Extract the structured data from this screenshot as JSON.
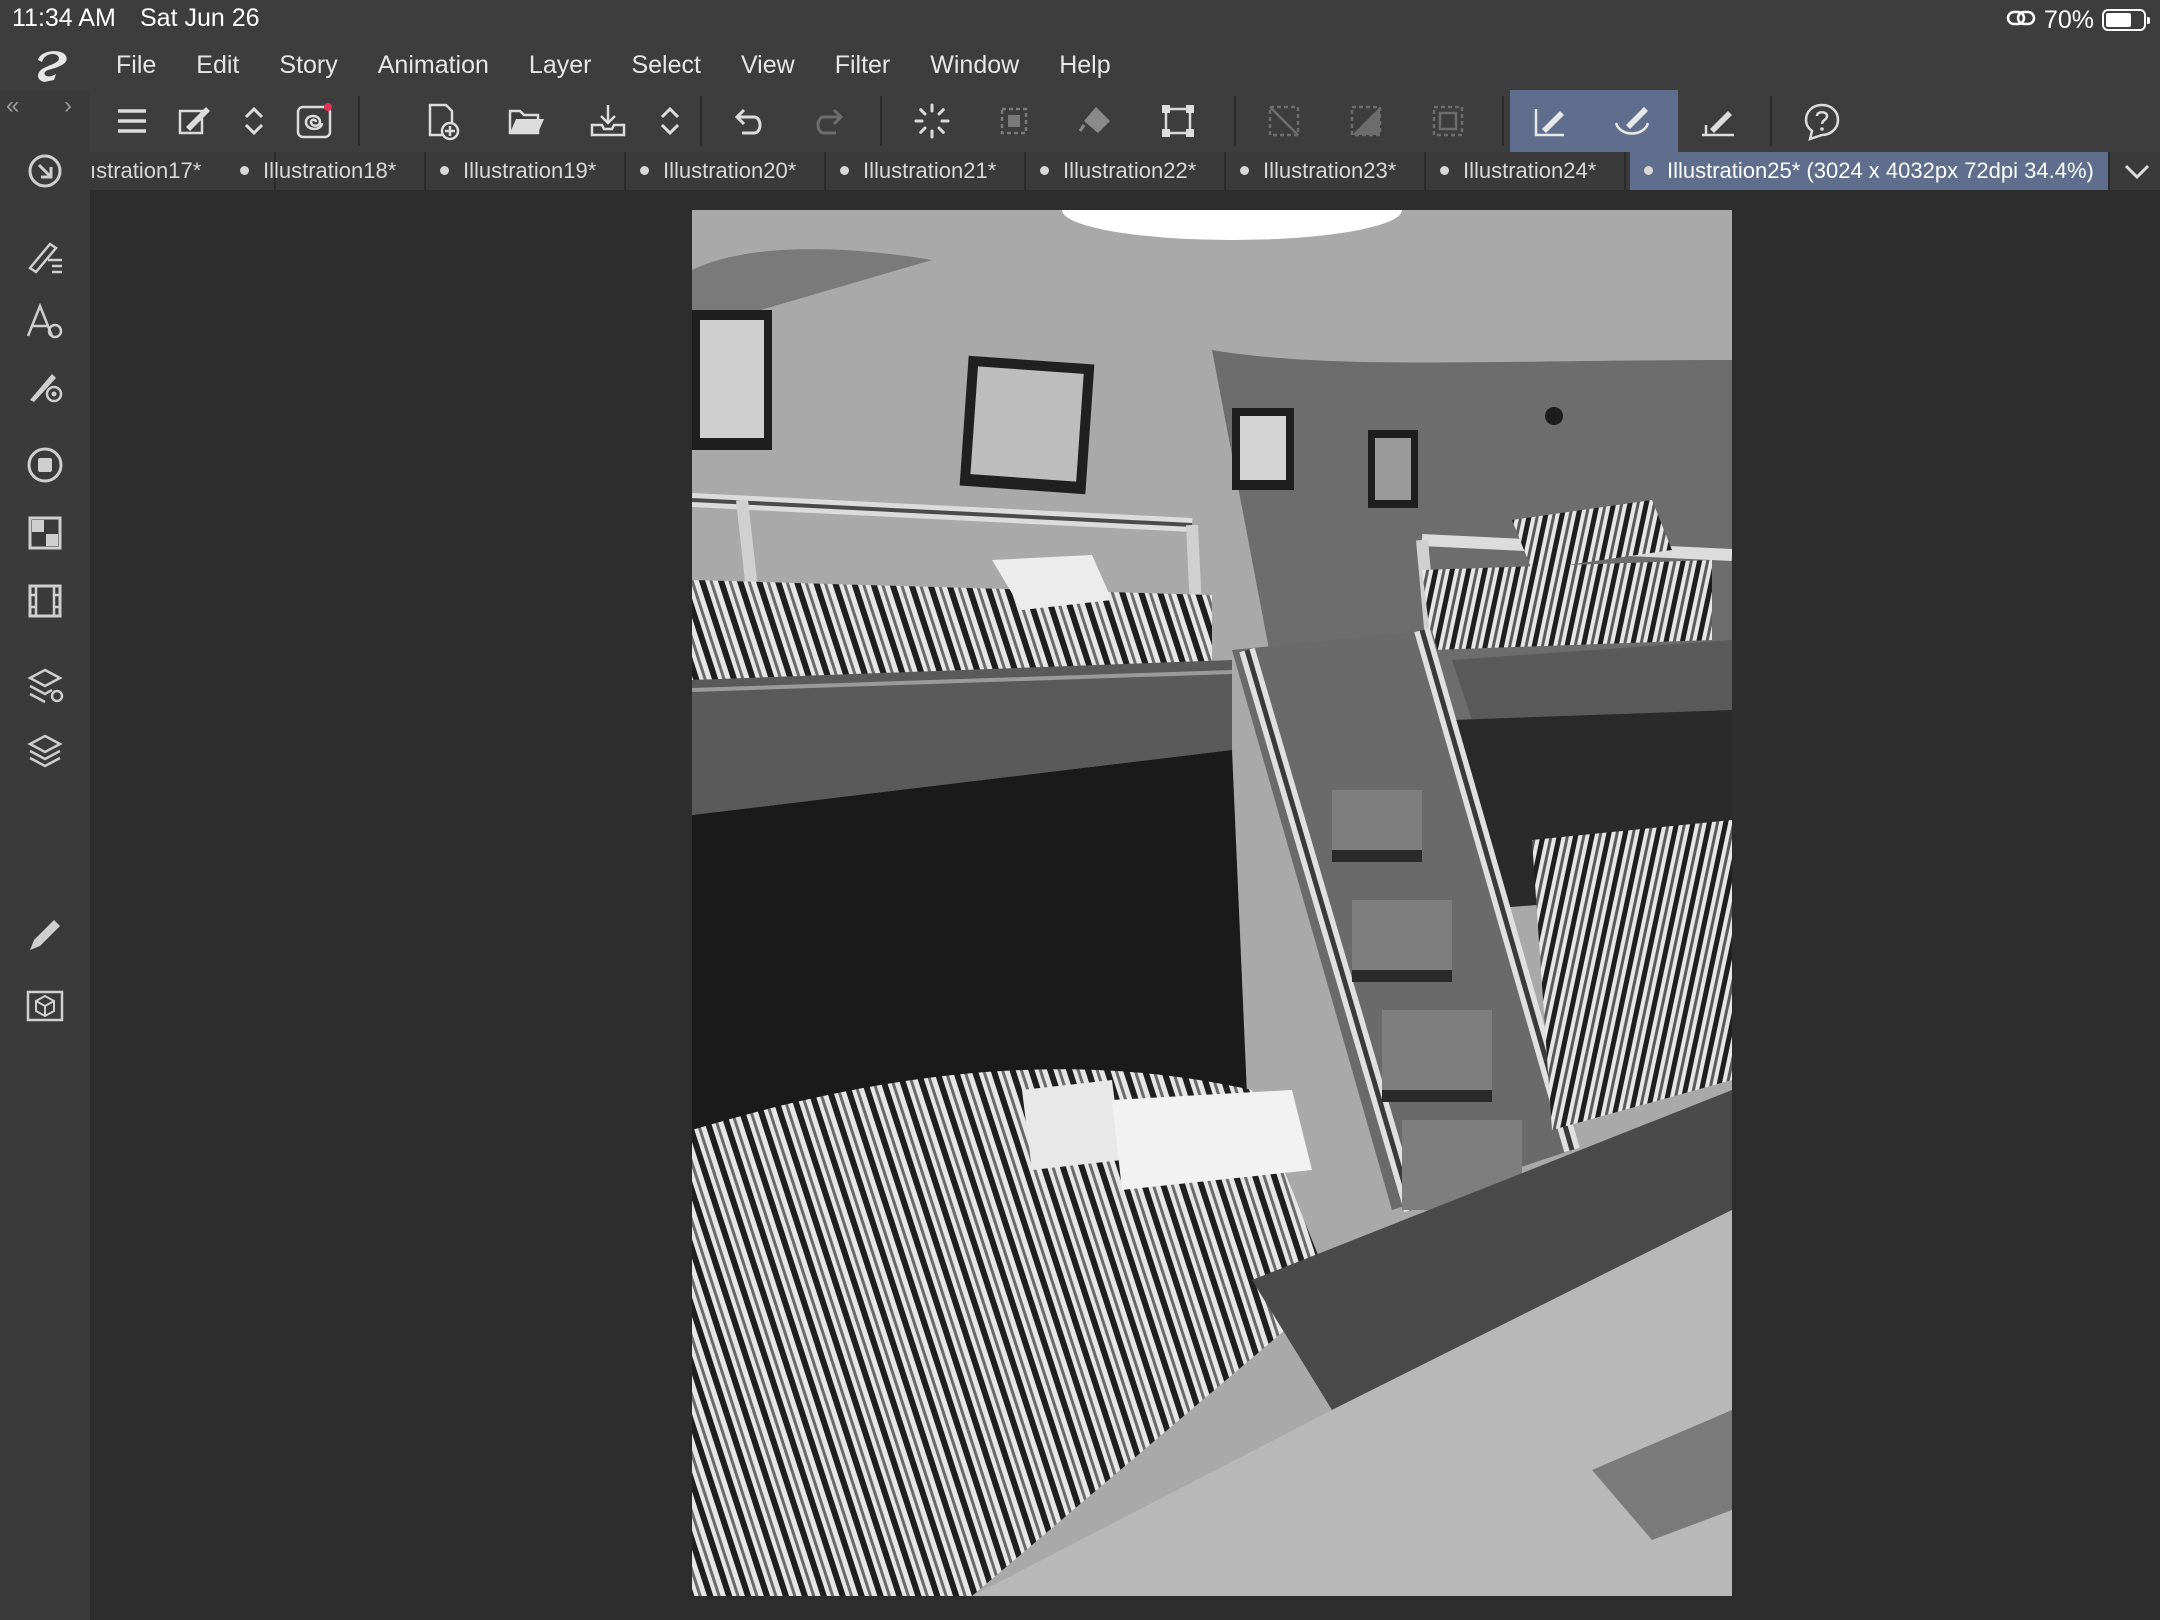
{
  "status_bar": {
    "time": "11:34 AM",
    "date": "Sat Jun 26",
    "battery_percent": "70%",
    "battery_level": 0.7
  },
  "menu": {
    "items": [
      "File",
      "Edit",
      "Story",
      "Animation",
      "Layer",
      "Select",
      "View",
      "Filter",
      "Window",
      "Help"
    ]
  },
  "tabs": [
    {
      "label": "ıstration17*",
      "dot": false
    },
    {
      "label": "Illustration18*",
      "dot": true
    },
    {
      "label": "Illustration19*",
      "dot": true
    },
    {
      "label": "Illustration20*",
      "dot": true
    },
    {
      "label": "Illustration21*",
      "dot": true
    },
    {
      "label": "Illustration22*",
      "dot": true
    },
    {
      "label": "Illustration23*",
      "dot": true
    },
    {
      "label": "Illustration24*",
      "dot": true
    },
    {
      "label": "Illustration25* (3024 x 4032px 72dpi 34.4%)",
      "dot": true,
      "active": true
    }
  ],
  "colors": {
    "accent": "#5e6e8c",
    "chrome": "#3d3d3d",
    "canvas_bg": "#2d2d2d",
    "notification_dot": "#e0335a"
  },
  "toolbar_icons": [
    "menu-icon",
    "modify-icon",
    "chevron-updown-icon",
    "spiral-icon",
    "new-file-icon",
    "open-folder-icon",
    "save-icon",
    "chevron-updown-icon",
    "undo-icon",
    "redo-icon",
    "loading-icon",
    "clear-selection-icon",
    "fill-icon",
    "transform-icon",
    "deselect-icon",
    "invert-selection-icon",
    "selection-border-icon",
    "pen-snap-icon",
    "brush-snap-icon",
    "ruler-icon",
    "help-icon"
  ],
  "side_icons": [
    "quick-access-icon",
    "tool-property-icon",
    "text-settings-icon",
    "brush-settings-icon",
    "color-icon",
    "material-icon",
    "timeline-icon",
    "layer-property-icon",
    "layers-icon",
    "pencil-icon",
    "3d-material-icon"
  ]
}
